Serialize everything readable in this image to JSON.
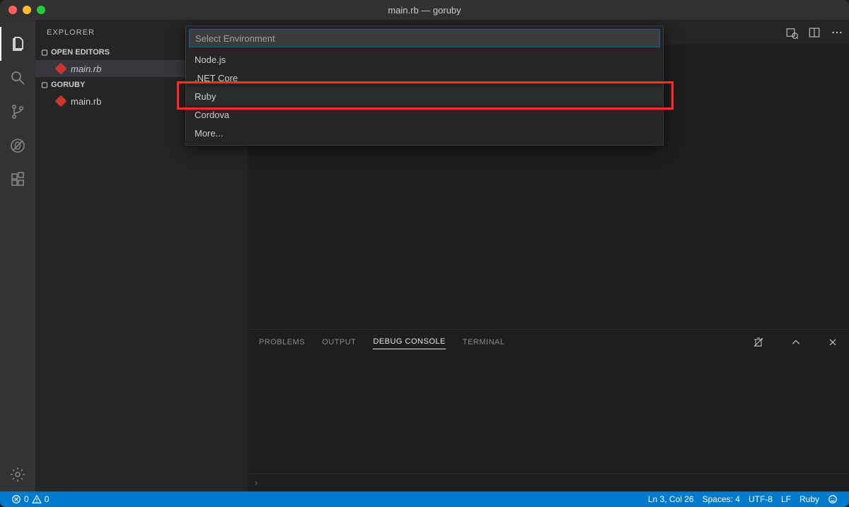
{
  "titlebar": {
    "title": "main.rb — goruby"
  },
  "sidebar": {
    "title": "EXPLORER",
    "open_editors_label": "OPEN EDITORS",
    "project_label": "GORUBY",
    "open_editors": [
      {
        "name": "main.rb"
      }
    ],
    "files": [
      {
        "name": "main.rb"
      }
    ]
  },
  "quickpick": {
    "placeholder": "Select Environment",
    "items": [
      "Node.js",
      ".NET Core",
      "Ruby",
      "Cordova",
      "More..."
    ],
    "highlighted_index": 2
  },
  "panel": {
    "tabs": [
      "PROBLEMS",
      "OUTPUT",
      "DEBUG CONSOLE",
      "TERMINAL"
    ],
    "active_tab_index": 2,
    "input_prompt": "›"
  },
  "statusbar": {
    "errors": "0",
    "warnings": "0",
    "cursor": "Ln 3, Col 26",
    "spaces": "Spaces: 4",
    "encoding": "UTF-8",
    "eol": "LF",
    "language": "Ruby"
  }
}
